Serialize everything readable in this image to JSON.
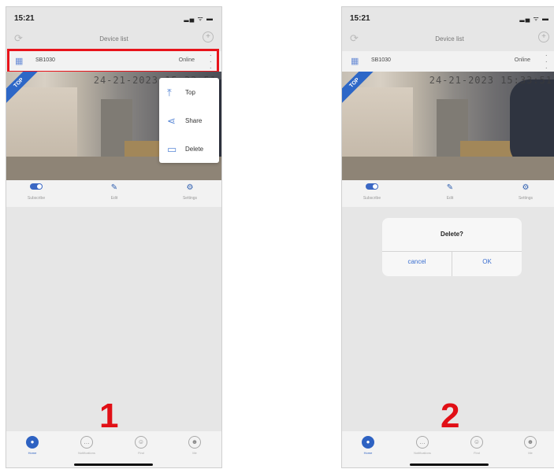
{
  "phones": [
    {
      "status_time": "15:21",
      "status_icons": "▂▄ ᯤ ▬",
      "nav_title": "Device list",
      "device": {
        "name": "SB1030",
        "status": "Online"
      },
      "camera_timestamp": "24-21-2023 15:33:51",
      "top_badge": "TOP",
      "actions": [
        "Subscribe",
        "Edit",
        "Settings"
      ],
      "menu": [
        "Top",
        "Share",
        "Delete"
      ],
      "tabs": [
        "Home",
        "Notifications",
        "Find",
        "Me"
      ],
      "step_number": "1"
    },
    {
      "status_time": "15:21",
      "status_icons": "▂▄ ᯤ ▬",
      "nav_title": "Device list",
      "device": {
        "name": "SB1030",
        "status": "Online"
      },
      "camera_timestamp": "24-21-2023 15:33:51",
      "top_badge": "TOP",
      "actions": [
        "Subscribe",
        "Edit",
        "Settings"
      ],
      "dialog": {
        "title": "Delete?",
        "cancel": "cancel",
        "ok": "OK"
      },
      "tabs": [
        "Home",
        "Notifications",
        "Find",
        "Me"
      ],
      "step_number": "2"
    }
  ],
  "colors": {
    "accent": "#2e62c2",
    "highlight": "#e8141b",
    "step_number": "#e10f16"
  }
}
